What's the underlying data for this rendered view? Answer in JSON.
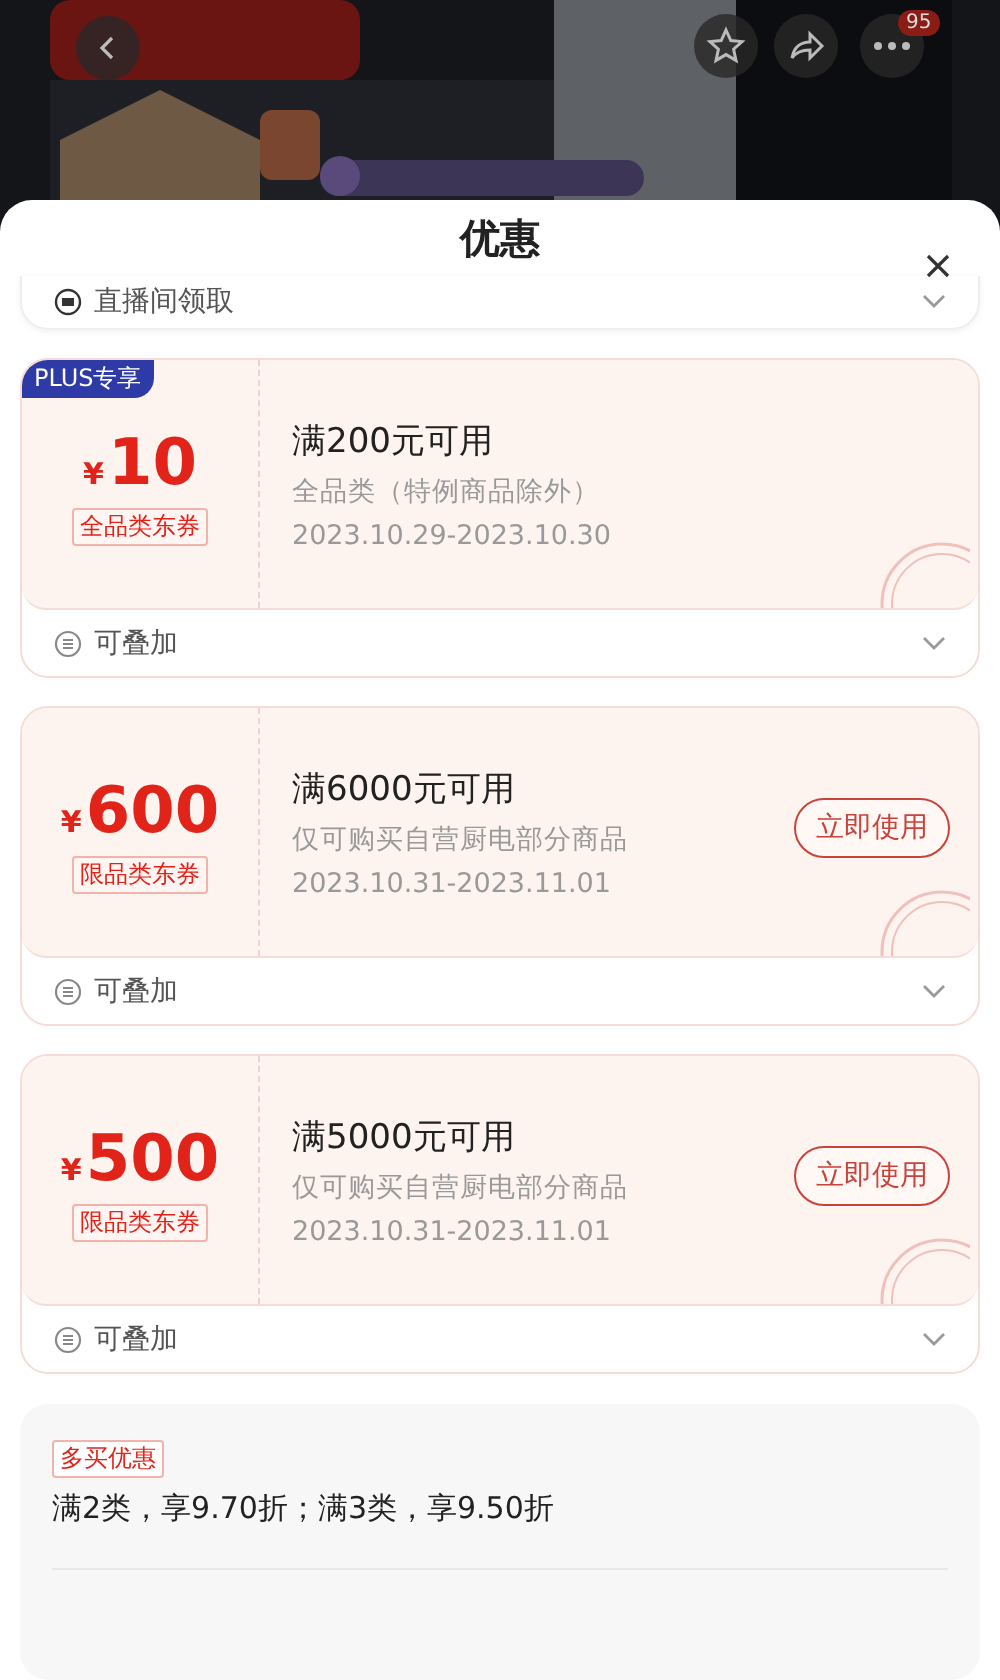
{
  "header": {
    "badge": "95"
  },
  "title": "优惠",
  "live_row": {
    "label": "直播间领取"
  },
  "coupons": [
    {
      "tag": "PLUS专享",
      "currency": "¥",
      "amount": "10",
      "category": "全品类东券",
      "condition": "满200元可用",
      "scope": "全品类（特例商品除外）",
      "dates": "2023.10.29-2023.10.30",
      "footer": "可叠加",
      "claimed": true
    },
    {
      "currency": "¥",
      "amount": "600",
      "category": "限品类东券",
      "condition": "满6000元可用",
      "scope": "仅可购买自营厨电部分商品",
      "dates": "2023.10.31-2023.11.01",
      "action": "立即使用",
      "footer": "可叠加",
      "claimed": true
    },
    {
      "currency": "¥",
      "amount": "500",
      "category": "限品类东券",
      "condition": "满5000元可用",
      "scope": "仅可购买自营厨电部分商品",
      "dates": "2023.10.31-2023.11.01",
      "action": "立即使用",
      "footer": "可叠加",
      "claimed": true
    }
  ],
  "multi_buy": {
    "tag": "多买优惠",
    "text": "满2类，享9.70折；满3类，享9.50折"
  }
}
